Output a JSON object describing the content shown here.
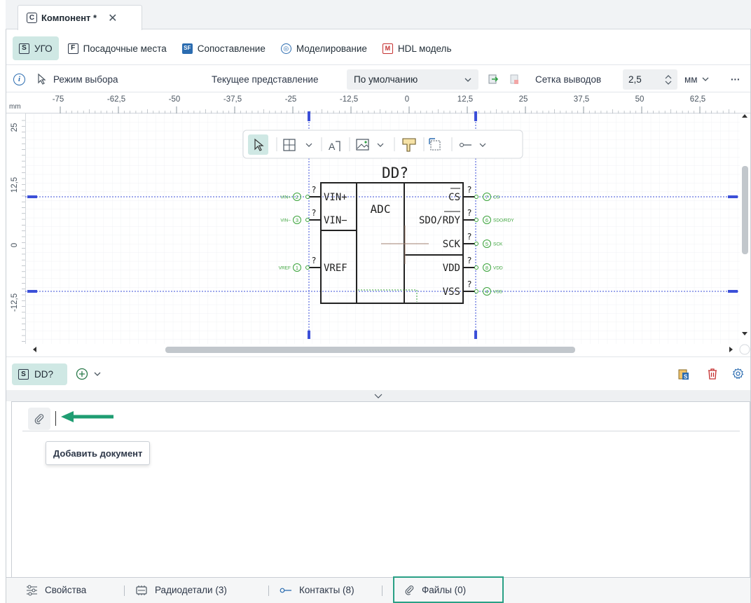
{
  "document_tab": {
    "icon_letter": "C",
    "title": "Компонент *",
    "close": "✕"
  },
  "view_tabs": [
    {
      "icon": "S",
      "label": "УГО",
      "active": true
    },
    {
      "icon": "F",
      "label": "Посадочные места"
    },
    {
      "icon": "SF",
      "label": "Сопоставление"
    },
    {
      "icon": "◎",
      "label": "Моделирование"
    },
    {
      "icon": "M",
      "label": "HDL модель"
    }
  ],
  "toolbar": {
    "info_icon": "i",
    "mode_label": "Режим выбора",
    "current_view_label": "Текущее представление",
    "current_view_value": "По умолчанию",
    "pin_grid_label": "Сетка выводов",
    "pin_grid_value": "2,5",
    "unit_value": "мм",
    "more": "···"
  },
  "ruler": {
    "unit": "mm",
    "x_ticks": [
      "-75",
      "-62,5",
      "-50",
      "-37,5",
      "-25",
      "-12,5",
      "0",
      "12,5",
      "25",
      "37,5",
      "50",
      "62,5"
    ],
    "y_ticks": [
      "25",
      "12,5",
      "0",
      "-12,5"
    ]
  },
  "schematic": {
    "designator": "DD?",
    "block_label": "ADC",
    "left_pins": [
      {
        "name": "VIN+",
        "num": "2",
        "net": "VIN+",
        "q": "?"
      },
      {
        "name": "VIN−",
        "num": "3",
        "net": "VIN−",
        "q": "?"
      },
      {
        "name": "VREF",
        "num": "1",
        "net": "VREF",
        "q": "?"
      }
    ],
    "right_pins": [
      {
        "name": "CS",
        "num": "7",
        "net": "CS",
        "q": "?"
      },
      {
        "name": "SDO/RDY",
        "num": "6",
        "net": "SDO/RDY",
        "q": "?"
      },
      {
        "name": "SCK",
        "num": "5",
        "net": "SCK",
        "q": "?"
      },
      {
        "name": "VDD",
        "num": "8",
        "net": "VDD",
        "q": "?"
      },
      {
        "name": "VSS",
        "num": "4",
        "net": "VSS",
        "q": "?"
      }
    ]
  },
  "selection": {
    "chip_icon": "S",
    "chip_label": "DD?",
    "add_icon": "+",
    "dropdown_icon": "v"
  },
  "files_panel": {
    "tooltip": "Добавить документ"
  },
  "bottom_tabs": [
    {
      "label": "Свойства",
      "icon": "sliders-icon"
    },
    {
      "label": "Радиодетали (3)",
      "icon": "chip-icon"
    },
    {
      "label": "Контакты (8)",
      "icon": "pin-icon"
    },
    {
      "label": "Файлы (0)",
      "icon": "paperclip-icon",
      "highlight": true
    }
  ],
  "colors": {
    "accent": "#29a085",
    "active_tab": "#cfe8e4",
    "guide": "#3b4fd8",
    "pin_green": "#3aa33a"
  }
}
